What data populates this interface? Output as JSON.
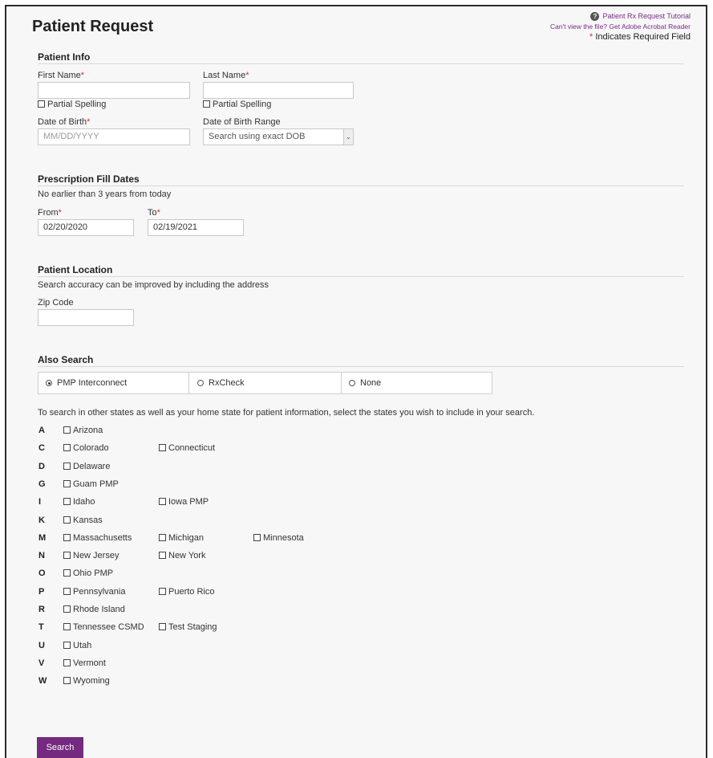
{
  "page": {
    "title": "Patient Request",
    "tutorial_link": "Patient Rx Request Tutorial",
    "acrobat_link": "Can't view the file? Get Adobe Acrobat Reader",
    "required_note": "Indicates Required Field",
    "required_mark": "*"
  },
  "patient_info": {
    "heading": "Patient Info",
    "first_name_label": "First Name",
    "last_name_label": "Last Name",
    "first_name_value": "",
    "last_name_value": "",
    "partial_spelling_label": "Partial Spelling",
    "dob_label": "Date of Birth",
    "dob_placeholder": "MM/DD/YYYY",
    "dob_range_label": "Date of Birth Range",
    "dob_range_selected": "Search using exact DOB"
  },
  "fill_dates": {
    "heading": "Prescription Fill Dates",
    "note": "No earlier than 3 years from today",
    "from_label": "From",
    "to_label": "To",
    "from_value": "02/20/2020",
    "to_value": "02/19/2021"
  },
  "location": {
    "heading": "Patient Location",
    "note": "Search accuracy can be improved by including the address",
    "zip_label": "Zip Code",
    "zip_value": ""
  },
  "also_search": {
    "heading": "Also Search",
    "options": [
      "PMP Interconnect",
      "RxCheck",
      "None"
    ],
    "selected": "PMP Interconnect",
    "instructions": "To search in other states as well as your home state for patient information, select the states you wish to include in your search."
  },
  "states": [
    {
      "letter": "A",
      "items": [
        "Arizona"
      ]
    },
    {
      "letter": "C",
      "items": [
        "Colorado",
        "Connecticut"
      ]
    },
    {
      "letter": "D",
      "items": [
        "Delaware"
      ]
    },
    {
      "letter": "G",
      "items": [
        "Guam PMP"
      ]
    },
    {
      "letter": "I",
      "items": [
        "Idaho",
        "Iowa PMP"
      ]
    },
    {
      "letter": "K",
      "items": [
        "Kansas"
      ]
    },
    {
      "letter": "M",
      "items": [
        "Massachusetts",
        "Michigan",
        "Minnesota"
      ]
    },
    {
      "letter": "N",
      "items": [
        "New Jersey",
        "New York"
      ]
    },
    {
      "letter": "O",
      "items": [
        "Ohio PMP"
      ]
    },
    {
      "letter": "P",
      "items": [
        "Pennsylvania",
        "Puerto Rico"
      ]
    },
    {
      "letter": "R",
      "items": [
        "Rhode Island"
      ]
    },
    {
      "letter": "T",
      "items": [
        "Tennessee CSMD",
        "Test Staging"
      ]
    },
    {
      "letter": "U",
      "items": [
        "Utah"
      ]
    },
    {
      "letter": "V",
      "items": [
        "Vermont"
      ]
    },
    {
      "letter": "W",
      "items": [
        "Wyoming"
      ]
    }
  ],
  "search_button": "Search",
  "colors": {
    "accent": "#742a7f",
    "link": "#7a2b86",
    "required": "#c0392b"
  }
}
